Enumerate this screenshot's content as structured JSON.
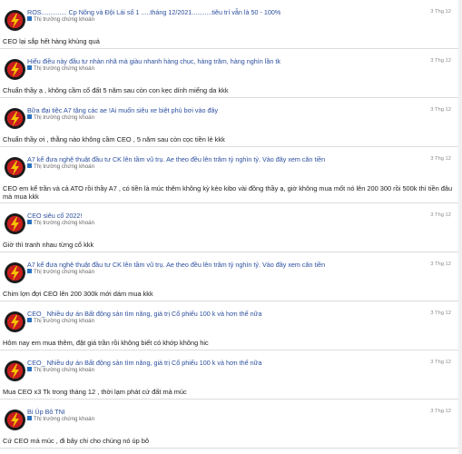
{
  "category_label": "Thị trường chứng khoán",
  "icons": {
    "avatar": "user-avatar-icon",
    "category": "blue-square-icon"
  },
  "colors": {
    "link": "#2c4f9e",
    "category_marker": "#2a73c0"
  },
  "posts": [
    {
      "title": "ROS.............. Cp Nông và Đội Lái số 1 .....tháng 12/2021...........tiêu trí vẫn là 50 - 100%",
      "date": "3 Thg 12",
      "body": "CEO lại sắp hết hàng khủng quá"
    },
    {
      "title": "Hiểu điều này đầu tư nhàn nhã mà giàu nhanh hàng chục, hàng trăm, hàng nghìn lần tk",
      "date": "3 Thg 12",
      "body": "Chuẩn thầy ạ , không cầm cổ đất 5 năm sau còn con kẹc dính miếng da kkk"
    },
    {
      "title": "Bữa đại tiệc A7 tặng các ae !Ai muốn siêu xe biệt phủ bơi vào đây",
      "date": "3 Thg 12",
      "body": "Chuẩn thầy ơi , thằng nào không cầm CEO , 5 năm sau còn cọc tiền lẻ kkk"
    },
    {
      "title": "A7 kể đưa nghệ thuật đầu tư CK lên tầm vũ trụ. Ae theo đều lên trăm tỷ nghìn tỷ. Vào đây xem căn tiền",
      "date": "3 Thg 12",
      "body": "CEO em kể trần và cả ATO rồi thầy A7 , có tiền là múc thêm không kỳ kèo kibo vài đồng thầy ạ, giờ không mua mốt nó lên 200 300 rồi 500k thì tiền đâu mà mua kkk"
    },
    {
      "title": "CEO siêu cổ 2022!",
      "date": "3 Thg 12",
      "body": "Giờ thì tranh nhau từng cổ kkk"
    },
    {
      "title": "A7 kể đưa nghệ thuật đầu tư CK lên tầm vũ trụ. Ae theo đều lên trăm tỷ nghìn tỷ. Vào đây xem căn tiền",
      "date": "3 Thg 12",
      "body": "Chim lợn đợi CEO lên 200 300k mới dám mua kkk"
    },
    {
      "title": "CEO_ Nhiều dự án Bất động sản tìm năng, giá trị Cổ phiếu 100 k và hơn thế nữa",
      "date": "3 Thg 12",
      "body": "Hôm nay em mua thêm, đặt giá trần rồi không biết có khớp không hic"
    },
    {
      "title": "CEO_ Nhiều dự án Bất động sản tìm năng, giá trị Cổ phiếu 100 k và hơn thế nữa",
      "date": "3 Thg 12",
      "body": "Mua CEO x3 Tk trong tháng 12 , thời lạm phát cứ đất mà múc"
    },
    {
      "title": "Bi Úp Bô TNI",
      "date": "3 Thg 12",
      "body": "Cứ CEO mà múc , đi bây chi cho chúng nó úp bô"
    }
  ]
}
